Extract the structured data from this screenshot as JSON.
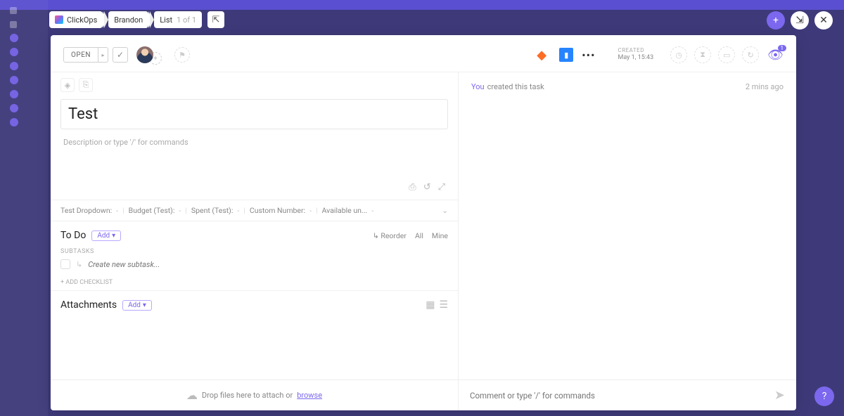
{
  "breadcrumb": {
    "space": "ClickOps",
    "folder": "Brandon",
    "list": "List",
    "count": "1 of 1"
  },
  "task": {
    "status": "OPEN",
    "title": "Test",
    "desc_placeholder": "Description or type '/' for commands",
    "created_label": "CREATED",
    "created_value": "May 1, 15:43",
    "watchers": "1"
  },
  "custom_fields": [
    {
      "label": "Test Dropdown:",
      "value": "-"
    },
    {
      "label": "Budget (Test):",
      "value": "-"
    },
    {
      "label": "Spent (Test):",
      "value": "-"
    },
    {
      "label": "Custom Number:",
      "value": "-"
    },
    {
      "label": "Available un...",
      "value": "-"
    }
  ],
  "todo": {
    "title": "To Do",
    "add": "Add",
    "reorder": "Reorder",
    "all": "All",
    "mine": "Mine",
    "subtasks_label": "SUBTASKS",
    "create_placeholder": "Create new subtask...",
    "add_checklist": "+ ADD CHECKLIST"
  },
  "attachments": {
    "title": "Attachments",
    "add": "Add"
  },
  "activity": {
    "you": "You",
    "text": "created this task",
    "time": "2 mins ago"
  },
  "footer": {
    "drop_prefix": "Drop files here to attach or ",
    "browse": "browse",
    "comment_placeholder": "Comment or type '/' for commands"
  }
}
